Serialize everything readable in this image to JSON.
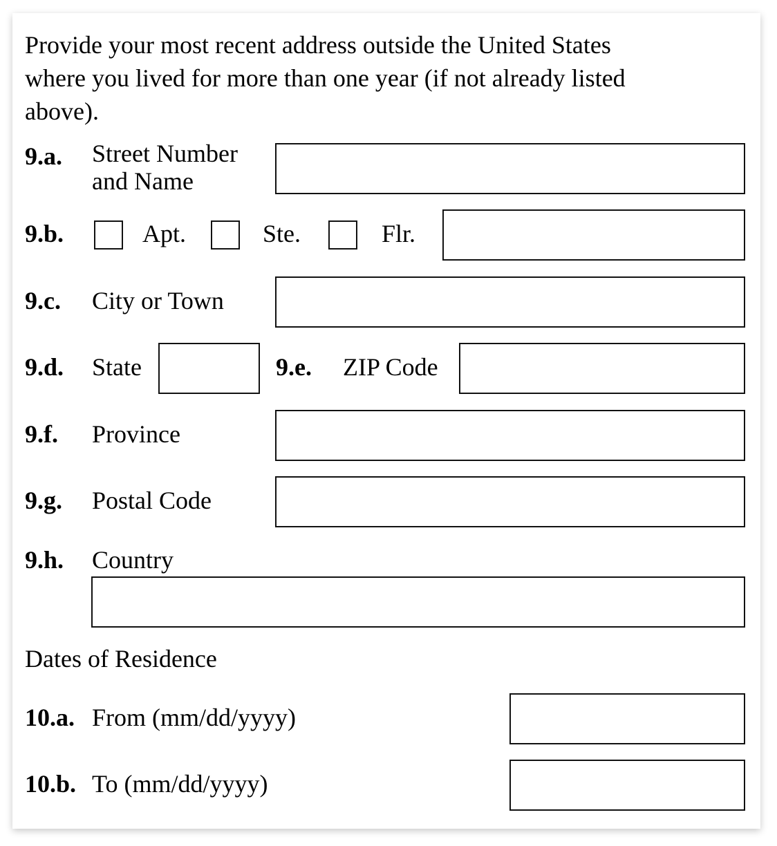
{
  "intro": "Provide your most recent address outside the United States\nwhere you lived for more than one year (if not already listed\nabove).",
  "fields": {
    "street": {
      "num": "9.a.",
      "label_line1": "Street Number",
      "label_line2": "and Name",
      "value": ""
    },
    "unit": {
      "num": "9.b.",
      "apt": "Apt.",
      "ste": "Ste.",
      "flr": "Flr.",
      "value": "",
      "apt_checked": false,
      "ste_checked": false,
      "flr_checked": false
    },
    "city": {
      "num": "9.c.",
      "label": "City or Town",
      "value": ""
    },
    "state": {
      "num": "9.d.",
      "label": "State",
      "value": ""
    },
    "zip": {
      "num": "9.e.",
      "label": "ZIP Code",
      "value": ""
    },
    "province": {
      "num": "9.f.",
      "label": "Province",
      "value": ""
    },
    "postal": {
      "num": "9.g.",
      "label": "Postal Code",
      "value": ""
    },
    "country": {
      "num": "9.h.",
      "label": "Country",
      "value": ""
    }
  },
  "dates": {
    "heading": "Dates of Residence",
    "from": {
      "num": "10.a.",
      "label": "From (mm/dd/yyyy)",
      "value": ""
    },
    "to": {
      "num": "10.b.",
      "label": "To (mm/dd/yyyy)",
      "value": ""
    }
  }
}
